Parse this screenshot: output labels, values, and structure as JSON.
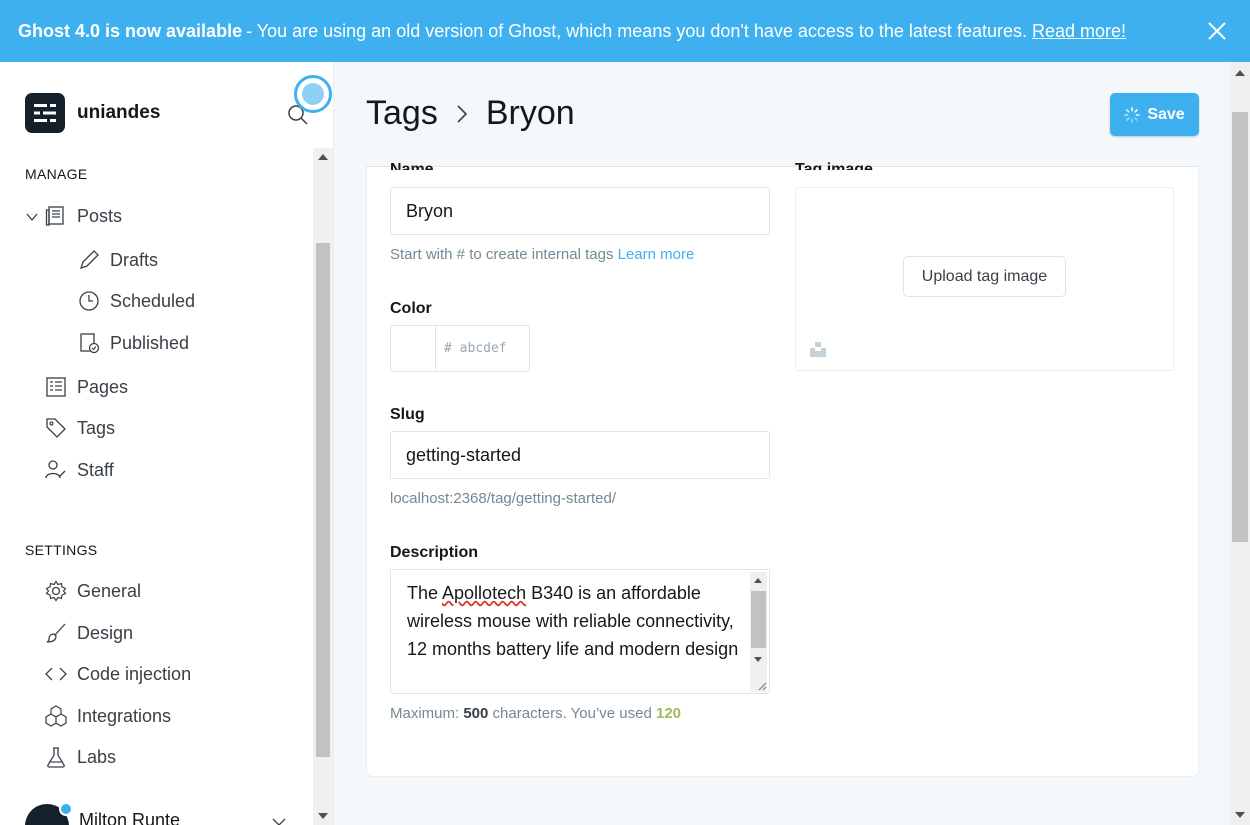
{
  "banner": {
    "title": "Ghost 4.0 is now available",
    "message": "- You are using an old version of Ghost, which means you don't have access to the latest features.",
    "link": "Read more!"
  },
  "sidebar": {
    "site_name": "uniandes",
    "manage_title": "MANAGE",
    "manage_items": [
      {
        "label": "Posts",
        "icon": "posts-icon"
      },
      {
        "label": "Drafts",
        "icon": "pencil-icon"
      },
      {
        "label": "Scheduled",
        "icon": "clock-icon"
      },
      {
        "label": "Published",
        "icon": "published-icon"
      },
      {
        "label": "Pages",
        "icon": "pages-icon"
      },
      {
        "label": "Tags",
        "icon": "tag-icon"
      },
      {
        "label": "Staff",
        "icon": "staff-icon"
      }
    ],
    "settings_title": "SETTINGS",
    "settings_items": [
      {
        "label": "General",
        "icon": "gear-icon"
      },
      {
        "label": "Design",
        "icon": "brush-icon"
      },
      {
        "label": "Code injection",
        "icon": "code-icon"
      },
      {
        "label": "Integrations",
        "icon": "integrations-icon"
      },
      {
        "label": "Labs",
        "icon": "flask-icon"
      }
    ],
    "user_name": "Milton Runte"
  },
  "header": {
    "breadcrumb_parent": "Tags",
    "breadcrumb_current": "Bryon",
    "save_label": "Save"
  },
  "form": {
    "name_label": "Name",
    "name_value": "Bryon",
    "name_help": "Start with # to create internal tags",
    "name_help_link": "Learn more",
    "color_label": "Color",
    "color_placeholder": "# abcdef",
    "slug_label": "Slug",
    "slug_value": "getting-started",
    "slug_url": "localhost:2368/tag/getting-started/",
    "description_label": "Description",
    "description_pre": "The ",
    "description_misspelled": "Apollotech",
    "description_post": " B340 is an affordable wireless mouse with reliable connectivity, 12 months battery life and modern design",
    "max_prefix": "Maximum:",
    "max_value": "500",
    "max_middle": "characters. You’ve used",
    "used_value": "120",
    "tag_image_label": "Tag image",
    "upload_label": "Upload tag image"
  },
  "colors": {
    "accent": "#3eb0ef",
    "sidebar_dark": "#15212a",
    "count_green": "#9fbb58"
  }
}
